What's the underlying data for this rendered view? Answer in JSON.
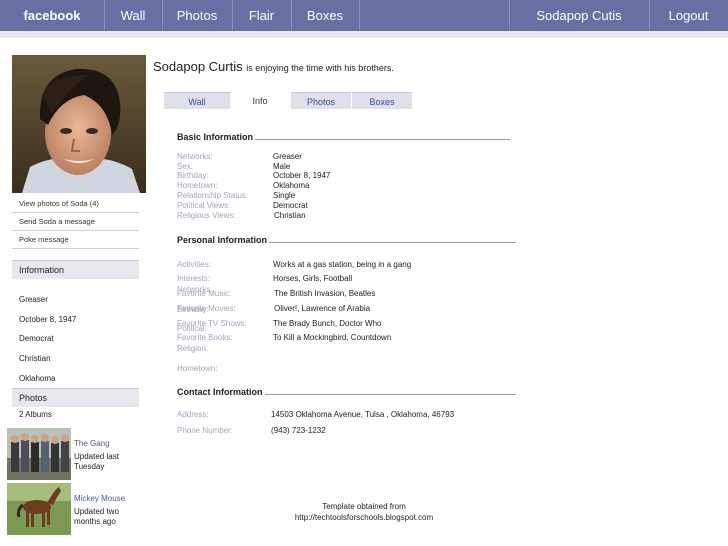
{
  "nav": {
    "brand": "facebook",
    "items": [
      "Wall",
      "Photos",
      "Flair",
      "Boxes"
    ],
    "user": "Sodapop Cutis",
    "logout": "Logout"
  },
  "sidebar": {
    "links": [
      "View photos of Soda (4)",
      "Send Soda a message",
      "Poke message"
    ],
    "information": {
      "heading": "Information",
      "rows": [
        {
          "label": "Networks:",
          "value": "Greaser"
        },
        {
          "label": "Birthday:",
          "value": "October 8, 1947"
        },
        {
          "label": "Political:",
          "value": "Democrat"
        },
        {
          "label": "Religion:",
          "value": "Christian"
        },
        {
          "label": "Hometown:",
          "value": "Oklahoma"
        }
      ]
    },
    "photos": {
      "heading": "Photos",
      "count": "2 Albums",
      "albums": [
        {
          "name": "The Gang",
          "updated": "Updated last Tuesday"
        },
        {
          "name": "Mickey Mouse",
          "updated": "Updated two months ago"
        }
      ]
    }
  },
  "profile": {
    "name": "Sodapop Curtis",
    "status": "is enjoying the time with his brothers."
  },
  "tabs": [
    {
      "label": "Wall",
      "active": false
    },
    {
      "label": "Info",
      "active": true
    },
    {
      "label": "Photos",
      "active": false
    },
    {
      "label": "Boxes",
      "active": false
    }
  ],
  "basic": {
    "title": "Basic Information",
    "rows": [
      {
        "label": "Networks:",
        "value": "Greaser"
      },
      {
        "label": "Sex:",
        "value": "Male"
      },
      {
        "label": "Birthday:",
        "value": "October 8, 1947"
      },
      {
        "label": "Hometown:",
        "value": "Oklahoma"
      },
      {
        "label": "Relationship Status:",
        "value": "Single"
      },
      {
        "label": "Political Views:",
        "value": "Democrat"
      },
      {
        "label": "Religious Views:",
        "value": "Christian"
      }
    ]
  },
  "personal": {
    "title": "Personal Information",
    "rows": [
      {
        "label": "Activities:",
        "value": "Works at a gas station, being in a gang"
      },
      {
        "label": "Interests:",
        "value": "Horses, Girls, Football"
      },
      {
        "label": "Favorite Music:",
        "value": "The British Invasion, Beatles"
      },
      {
        "label": "Favorite Movies:",
        "value": "Oliver!, Lawrence of Arabia"
      },
      {
        "label": "Favorite TV Shows:",
        "value": "The Brady Bunch, Doctor Who"
      },
      {
        "label": "Favorite Books:",
        "value": "To Kill a Mockingbird, Countdown"
      }
    ]
  },
  "contact": {
    "title": "Contact Information",
    "rows": [
      {
        "label": "Address:",
        "value": "14503 Oklahoma Avenue,  Tulsa , Oklahoma, 46793"
      },
      {
        "label": "Phone Number:",
        "value": "(943) 723-1232"
      }
    ]
  },
  "footer": {
    "line1": "Template obtained from",
    "line2": "http://techtoolsforschools.blogspot.com"
  }
}
